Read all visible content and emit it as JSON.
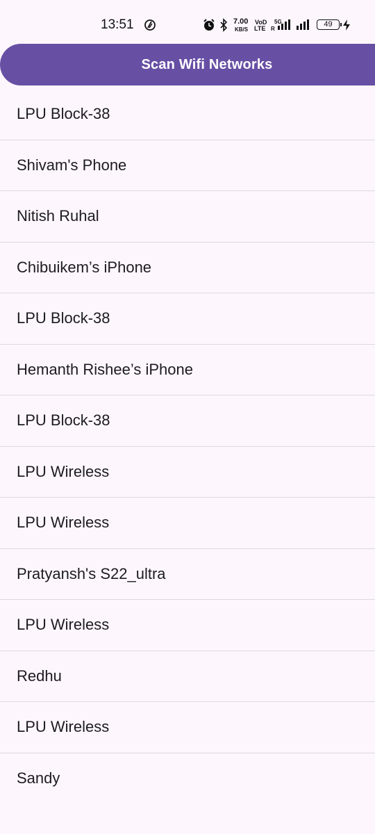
{
  "status_bar": {
    "time": "13:51",
    "speed_value": "7.00",
    "speed_unit": "KB/S",
    "volte_top": "VoD",
    "volte_bottom": "LTE",
    "network_type": "5G",
    "roaming": "R",
    "battery_level": "49",
    "icons": [
      "sync-icon",
      "alarm-icon",
      "bluetooth-icon",
      "signal-icon",
      "signal-icon",
      "charging-icon"
    ]
  },
  "header": {
    "scan_label": "Scan Wifi Networks",
    "accent_color": "#6750a4"
  },
  "networks": [
    "LPU Block-38",
    "Shivam's Phone",
    "Nitish Ruhal",
    "Chibuikem’s iPhone",
    "LPU Block-38",
    "Hemanth Rishee’s iPhone",
    "LPU Block-38",
    "LPU Wireless",
    "LPU Wireless",
    "Pratyansh's S22_ultra",
    "LPU Wireless",
    "Redhu",
    "LPU Wireless",
    "Sandy"
  ]
}
